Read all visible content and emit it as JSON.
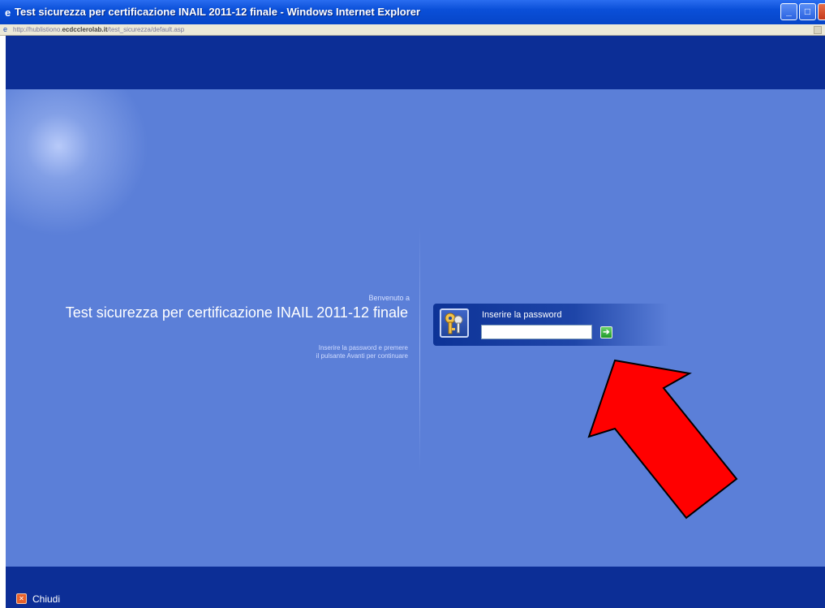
{
  "window": {
    "title": "Test sicurezza per certificazione INAIL 2011-12 finale - Windows Internet Explorer",
    "icon": "ie-icon",
    "controls": {
      "minimize": "_",
      "maximize": "□",
      "close": "X"
    }
  },
  "addressbar": {
    "url_prefix": "http://hublistiono.",
    "url_domain": "ecdcclerolab.it",
    "url_suffix": "/test_sicurezza/default.asp"
  },
  "welcome": {
    "greeting": "Benvenuto a",
    "title": "Test sicurezza per certificazione INAIL 2011-12 finale",
    "instructions_line1": "Inserire la password e premere",
    "instructions_line2": "il pulsante Avanti per continuare"
  },
  "login": {
    "icon": "keys-icon",
    "label": "Inserire la password",
    "input_value": "",
    "go_icon": "arrow-right-icon",
    "go_symbol": "➔"
  },
  "footer": {
    "close_icon": "close-icon",
    "close_label": "Chiudi"
  },
  "colors": {
    "page_bg": "#5b7fd8",
    "band": "#0c2e96",
    "annotation_arrow": "#ff0000"
  }
}
